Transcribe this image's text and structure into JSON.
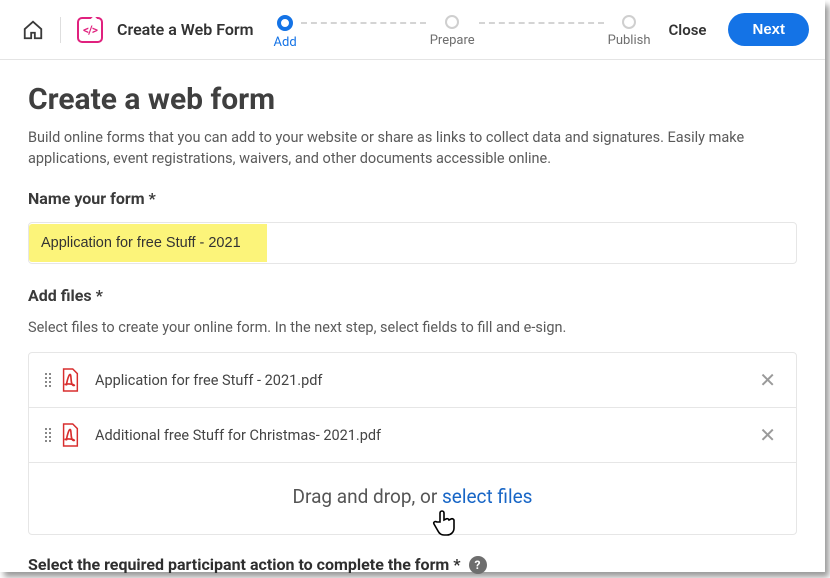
{
  "header": {
    "title": "Create a Web Form",
    "steps": [
      {
        "label": "Add",
        "active": true
      },
      {
        "label": "Prepare",
        "active": false
      },
      {
        "label": "Publish",
        "active": false
      }
    ],
    "close_label": "Close",
    "next_label": "Next"
  },
  "page": {
    "title": "Create a web form",
    "description": "Build online forms that you can add to your website or share as links to collect data and signatures. Easily make applications, event registrations, waivers, and other documents accessible online."
  },
  "name_field": {
    "label": "Name your form *",
    "value": "Application for free Stuff - 2021"
  },
  "files_section": {
    "label": "Add files *",
    "help": "Select files to create your online form. In the next step, select fields to fill and e-sign.",
    "files": [
      {
        "name": "Application for free Stuff - 2021.pdf"
      },
      {
        "name": "Additional free Stuff for Christmas- 2021.pdf"
      }
    ],
    "drop_text": "Drag and drop, or ",
    "drop_link": "select files"
  },
  "action_section": {
    "label": "Select the required participant action to complete the form *",
    "help_glyph": "?"
  }
}
